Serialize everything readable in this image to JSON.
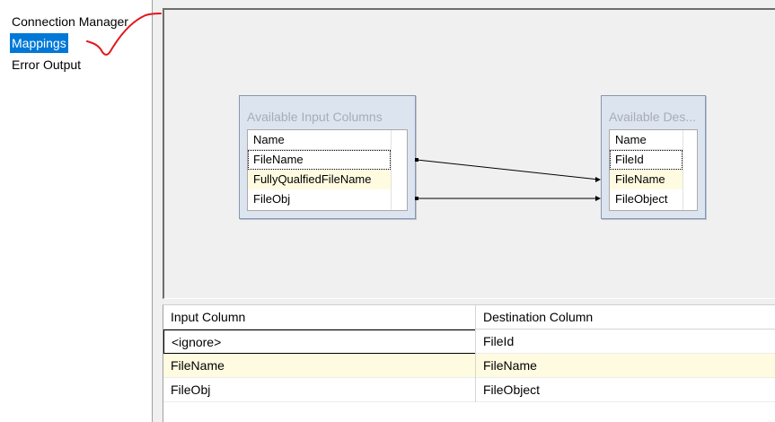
{
  "nav": {
    "items": [
      {
        "label": "Connection Manager",
        "selected": false
      },
      {
        "label": "Mappings",
        "selected": true
      },
      {
        "label": "Error Output",
        "selected": false
      }
    ]
  },
  "annotation": {
    "icon": "red-checkmark-annotation",
    "color": "#e3161b"
  },
  "diagram": {
    "input_box": {
      "title": "Available Input Columns",
      "header": "Name",
      "columns": [
        "FileName",
        "FullyQualfiedFileName",
        "FileObj"
      ]
    },
    "destination_box": {
      "title": "Available Des...",
      "header": "Name",
      "columns": [
        "FileId",
        "FileName",
        "FileObject"
      ]
    }
  },
  "mappings": {
    "headers": [
      "Input Column",
      "Destination Column"
    ],
    "rows": [
      {
        "input": "<ignore>",
        "destination": "FileId"
      },
      {
        "input": "FileName",
        "destination": "FileName"
      },
      {
        "input": "FileObj",
        "destination": "FileObject"
      }
    ]
  },
  "colors": {
    "selection": "#0078d7",
    "row_highlight": "#fffbe1",
    "box_background": "#dce4ef"
  }
}
